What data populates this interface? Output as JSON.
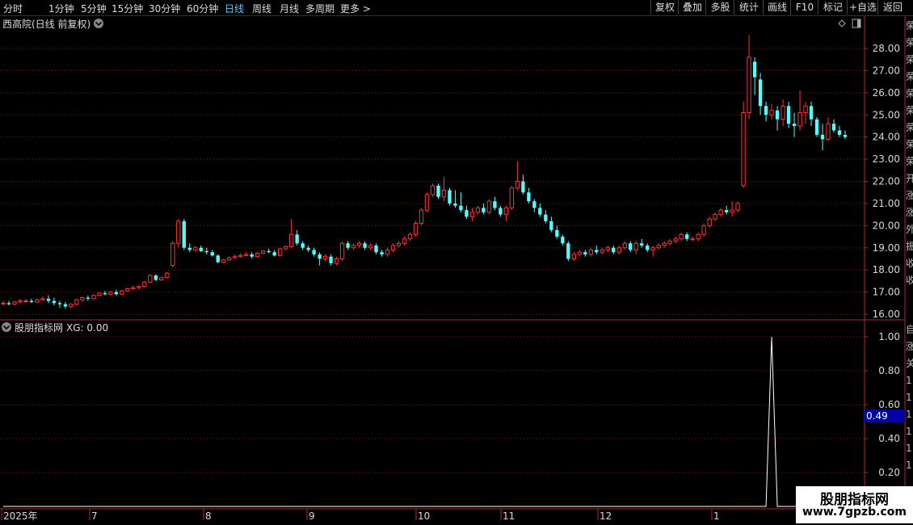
{
  "toolbar": {
    "periods": [
      "分时",
      "1分钟",
      "5分钟",
      "15分钟",
      "30分钟",
      "60分钟",
      "日线",
      "周线",
      "月线",
      "多周期",
      "更多 >"
    ],
    "active_period": "日线",
    "right_buttons": [
      "复权",
      "叠加",
      "多股",
      "统计",
      "画线",
      "F10",
      "标记",
      "+自选",
      "返回"
    ]
  },
  "main_title": "西高院(日线 前复权)",
  "main_expand_icon": "chevron-down-icon",
  "sub_title": "股朋指标网",
  "sub_value": "XG: 0.00",
  "sub_expand_icon": "chevron-down-icon",
  "sub_cursor_value": "0.49",
  "watermark": {
    "title": "股朋指标网",
    "url": "www.7gpzb.com"
  },
  "x_axis_labels": [
    "2025年",
    "7",
    "8",
    "9",
    "10",
    "11",
    "12",
    "1"
  ],
  "colors": {
    "up": "#ff3232",
    "down": "#54ffff",
    "axis": "#b0282d",
    "grid": "#6a1e1e",
    "text": "#d8d8d8",
    "cursor_box": "#0000aa"
  },
  "chart_data": [
    {
      "type": "candlestick",
      "title": "西高院(日线 前复权)",
      "y_ticks": [
        "28.00",
        "27.00",
        "26.00",
        "25.00",
        "24.00",
        "23.00",
        "22.00",
        "21.00",
        "20.00",
        "19.00",
        "18.00",
        "17.00",
        "16.00"
      ],
      "ylim": [
        15.5,
        28.5
      ],
      "note": "每根K线为 [开, 高, 低, 收]",
      "candles": [
        [
          16.5,
          16.6,
          16.4,
          16.5
        ],
        [
          16.5,
          16.6,
          16.4,
          16.45
        ],
        [
          16.45,
          16.6,
          16.4,
          16.55
        ],
        [
          16.55,
          16.7,
          16.5,
          16.6
        ],
        [
          16.6,
          16.7,
          16.5,
          16.6
        ],
        [
          16.6,
          16.7,
          16.5,
          16.55
        ],
        [
          16.55,
          16.7,
          16.5,
          16.65
        ],
        [
          16.65,
          16.8,
          16.6,
          16.7
        ],
        [
          16.7,
          16.85,
          16.5,
          16.6
        ],
        [
          16.6,
          16.75,
          16.4,
          16.5
        ],
        [
          16.5,
          16.6,
          16.3,
          16.45
        ],
        [
          16.45,
          16.55,
          16.25,
          16.35
        ],
        [
          16.35,
          16.5,
          16.25,
          16.45
        ],
        [
          16.45,
          16.7,
          16.4,
          16.65
        ],
        [
          16.65,
          16.8,
          16.55,
          16.75
        ],
        [
          16.75,
          16.85,
          16.6,
          16.7
        ],
        [
          16.7,
          16.9,
          16.65,
          16.85
        ],
        [
          16.85,
          17.0,
          16.8,
          16.95
        ],
        [
          16.95,
          17.05,
          16.85,
          16.9
        ],
        [
          16.9,
          17.05,
          16.85,
          17.0
        ],
        [
          17.0,
          17.1,
          16.85,
          16.9
        ],
        [
          16.9,
          17.1,
          16.85,
          17.05
        ],
        [
          17.05,
          17.2,
          17.0,
          17.15
        ],
        [
          17.15,
          17.3,
          17.1,
          17.2
        ],
        [
          17.2,
          17.3,
          17.1,
          17.25
        ],
        [
          17.25,
          17.5,
          17.2,
          17.45
        ],
        [
          17.45,
          17.8,
          17.4,
          17.75
        ],
        [
          17.75,
          17.8,
          17.5,
          17.55
        ],
        [
          17.55,
          17.7,
          17.5,
          17.65
        ],
        [
          17.65,
          17.9,
          17.6,
          17.85
        ],
        [
          18.2,
          19.3,
          18.1,
          19.2
        ],
        [
          19.2,
          20.3,
          19.0,
          20.2
        ],
        [
          20.2,
          20.3,
          18.9,
          19.0
        ],
        [
          19.0,
          19.2,
          18.8,
          18.9
        ],
        [
          18.9,
          19.1,
          18.8,
          19.0
        ],
        [
          19.0,
          19.1,
          18.8,
          18.85
        ],
        [
          18.85,
          19.0,
          18.7,
          18.8
        ],
        [
          18.8,
          18.9,
          18.6,
          18.65
        ],
        [
          18.65,
          18.7,
          18.3,
          18.35
        ],
        [
          18.35,
          18.5,
          18.3,
          18.45
        ],
        [
          18.45,
          18.6,
          18.4,
          18.55
        ],
        [
          18.55,
          18.7,
          18.5,
          18.6
        ],
        [
          18.6,
          18.75,
          18.55,
          18.65
        ],
        [
          18.65,
          18.8,
          18.6,
          18.7
        ],
        [
          18.7,
          18.8,
          18.5,
          18.6
        ],
        [
          18.6,
          18.8,
          18.55,
          18.75
        ],
        [
          18.75,
          18.9,
          18.7,
          18.85
        ],
        [
          18.85,
          18.95,
          18.75,
          18.8
        ],
        [
          18.8,
          18.9,
          18.6,
          18.65
        ],
        [
          18.65,
          19.0,
          18.6,
          18.95
        ],
        [
          18.95,
          19.1,
          18.9,
          19.05
        ],
        [
          19.05,
          20.3,
          19.0,
          19.6
        ],
        [
          19.6,
          19.8,
          19.1,
          19.2
        ],
        [
          19.2,
          19.3,
          18.9,
          19.0
        ],
        [
          19.0,
          19.1,
          18.8,
          18.9
        ],
        [
          18.9,
          19.0,
          18.6,
          18.7
        ],
        [
          18.7,
          18.8,
          18.2,
          18.5
        ],
        [
          18.5,
          18.7,
          18.4,
          18.6
        ],
        [
          18.6,
          18.7,
          18.2,
          18.3
        ],
        [
          18.3,
          18.6,
          18.2,
          18.5
        ],
        [
          18.5,
          19.3,
          18.4,
          19.2
        ],
        [
          19.2,
          19.3,
          18.9,
          19.0
        ],
        [
          19.0,
          19.2,
          18.9,
          19.1
        ],
        [
          19.1,
          19.3,
          19.0,
          19.2
        ],
        [
          19.2,
          19.3,
          18.9,
          19.0
        ],
        [
          19.0,
          19.2,
          18.9,
          19.1
        ],
        [
          19.1,
          19.2,
          18.7,
          18.8
        ],
        [
          18.8,
          18.9,
          18.6,
          18.7
        ],
        [
          18.7,
          19.0,
          18.6,
          18.9
        ],
        [
          18.9,
          19.2,
          18.8,
          19.1
        ],
        [
          19.1,
          19.3,
          19.0,
          19.2
        ],
        [
          19.2,
          19.5,
          19.1,
          19.4
        ],
        [
          19.4,
          19.7,
          19.3,
          19.6
        ],
        [
          19.6,
          20.2,
          19.5,
          20.1
        ],
        [
          20.1,
          20.8,
          20.0,
          20.7
        ],
        [
          20.7,
          21.5,
          20.6,
          21.4
        ],
        [
          21.4,
          21.9,
          21.3,
          21.8
        ],
        [
          21.8,
          21.9,
          21.2,
          21.3
        ],
        [
          21.3,
          22.2,
          21.1,
          21.6
        ],
        [
          21.6,
          21.7,
          20.9,
          21.0
        ],
        [
          21.0,
          21.6,
          20.8,
          20.9
        ],
        [
          20.9,
          21.5,
          20.6,
          20.7
        ],
        [
          20.7,
          20.9,
          20.3,
          20.4
        ],
        [
          20.4,
          20.8,
          20.2,
          20.6
        ],
        [
          20.6,
          20.9,
          20.5,
          20.8
        ],
        [
          20.8,
          21.0,
          20.5,
          20.6
        ],
        [
          20.6,
          21.2,
          20.5,
          21.1
        ],
        [
          21.1,
          21.3,
          20.7,
          20.8
        ],
        [
          20.8,
          20.9,
          20.4,
          20.5
        ],
        [
          20.5,
          20.9,
          20.2,
          20.8
        ],
        [
          20.8,
          21.8,
          20.7,
          21.7
        ],
        [
          21.7,
          22.9,
          21.6,
          22.0
        ],
        [
          22.0,
          22.3,
          21.4,
          21.5
        ],
        [
          21.5,
          21.7,
          21.0,
          21.1
        ],
        [
          21.1,
          21.2,
          20.6,
          20.8
        ],
        [
          20.8,
          21.0,
          20.4,
          20.5
        ],
        [
          20.5,
          20.7,
          20.1,
          20.2
        ],
        [
          20.2,
          20.4,
          19.7,
          19.8
        ],
        [
          19.8,
          20.0,
          19.4,
          19.5
        ],
        [
          19.5,
          19.6,
          19.1,
          19.2
        ],
        [
          19.2,
          19.3,
          18.4,
          18.5
        ],
        [
          18.5,
          18.8,
          18.4,
          18.7
        ],
        [
          18.7,
          18.9,
          18.6,
          18.8
        ],
        [
          18.8,
          18.9,
          18.6,
          18.7
        ],
        [
          18.7,
          19.0,
          18.6,
          18.9
        ],
        [
          18.9,
          19.1,
          18.7,
          18.8
        ],
        [
          18.8,
          19.0,
          18.7,
          18.9
        ],
        [
          18.9,
          19.1,
          18.8,
          19.0
        ],
        [
          19.0,
          19.1,
          18.7,
          18.8
        ],
        [
          18.8,
          19.1,
          18.7,
          19.0
        ],
        [
          19.0,
          19.3,
          18.9,
          19.2
        ],
        [
          19.2,
          19.3,
          18.8,
          18.9
        ],
        [
          18.9,
          19.3,
          18.7,
          19.2
        ],
        [
          19.2,
          19.4,
          19.0,
          19.1
        ],
        [
          19.1,
          19.2,
          18.8,
          18.9
        ],
        [
          18.9,
          19.1,
          18.6,
          19.0
        ],
        [
          19.0,
          19.2,
          18.9,
          19.1
        ],
        [
          19.1,
          19.3,
          19.0,
          19.2
        ],
        [
          19.2,
          19.4,
          19.1,
          19.3
        ],
        [
          19.3,
          19.5,
          19.2,
          19.4
        ],
        [
          19.4,
          19.7,
          19.3,
          19.6
        ],
        [
          19.6,
          19.7,
          19.3,
          19.4
        ],
        [
          19.4,
          19.5,
          19.3,
          19.4
        ],
        [
          19.4,
          19.7,
          19.3,
          19.6
        ],
        [
          19.6,
          20.1,
          19.5,
          20.0
        ],
        [
          20.0,
          20.4,
          19.9,
          20.3
        ],
        [
          20.3,
          20.6,
          20.2,
          20.5
        ],
        [
          20.5,
          20.8,
          20.4,
          20.7
        ],
        [
          20.7,
          20.9,
          20.5,
          20.6
        ],
        [
          20.6,
          21.1,
          20.4,
          20.7
        ],
        [
          20.7,
          21.1,
          20.6,
          21.0
        ],
        [
          21.8,
          25.6,
          21.7,
          25.1
        ],
        [
          25.1,
          28.6,
          24.8,
          27.6
        ],
        [
          27.4,
          27.6,
          25.9,
          26.7
        ],
        [
          26.6,
          26.9,
          25.0,
          25.4
        ],
        [
          25.4,
          25.6,
          24.7,
          25.0
        ],
        [
          25.0,
          25.5,
          24.8,
          25.2
        ],
        [
          25.2,
          25.4,
          24.3,
          24.8
        ],
        [
          24.8,
          25.7,
          24.5,
          25.4
        ],
        [
          25.4,
          25.6,
          24.4,
          24.6
        ],
        [
          24.6,
          25.1,
          24.0,
          24.5
        ],
        [
          24.5,
          26.1,
          24.3,
          25.1
        ],
        [
          25.1,
          25.6,
          24.6,
          25.4
        ],
        [
          25.4,
          25.6,
          24.5,
          24.8
        ],
        [
          24.8,
          24.9,
          24.0,
          24.1
        ],
        [
          24.1,
          24.6,
          23.4,
          23.9
        ],
        [
          23.9,
          24.9,
          23.8,
          24.6
        ],
        [
          24.6,
          24.8,
          24.2,
          24.3
        ],
        [
          24.3,
          24.5,
          24.0,
          24.1
        ],
        [
          24.1,
          24.3,
          23.9,
          24.0
        ]
      ]
    },
    {
      "type": "line",
      "title": "股朋指标网",
      "series_label": "XG",
      "y_ticks": [
        "1.00",
        "0.80",
        "0.60",
        "0.40",
        "0.20"
      ],
      "ylim": [
        0,
        1
      ],
      "values_note": "XG为0,仅在一根K线处为1",
      "spike_index": 136
    }
  ]
}
